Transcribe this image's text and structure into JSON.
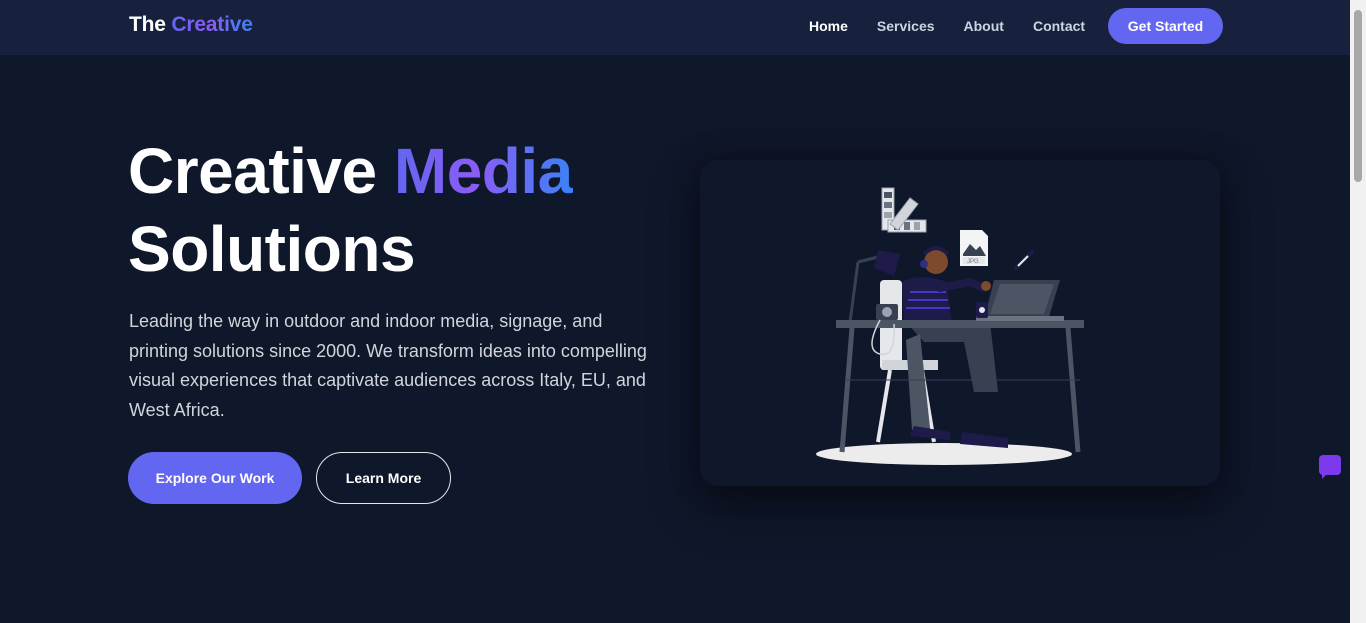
{
  "nav": {
    "brand_part1": "The",
    "brand_part2": "Creative",
    "links": [
      "Home",
      "Services",
      "About",
      "Contact"
    ],
    "cta": "Get Started"
  },
  "hero": {
    "title_part1": "Creative",
    "title_highlight": "Media",
    "title_part2": "Solutions",
    "description": "Leading the way in outdoor and indoor media, signage, and printing solutions since 2000. We transform ideas into compelling visual experiences that captivate audiences across Italy, EU, and West Africa.",
    "primary_button": "Explore Our Work",
    "secondary_button": "Learn More",
    "illustration_file_label": "JPG"
  },
  "colors": {
    "background": "#0f172a",
    "navbar": "#17213d",
    "accent": "#6366f1",
    "gradient_mid": "#8b5cf6",
    "gradient_end": "#3b82f6"
  },
  "icons": {
    "chat": "chat-widget-icon",
    "illustration": "designer-at-desk-illustration"
  }
}
